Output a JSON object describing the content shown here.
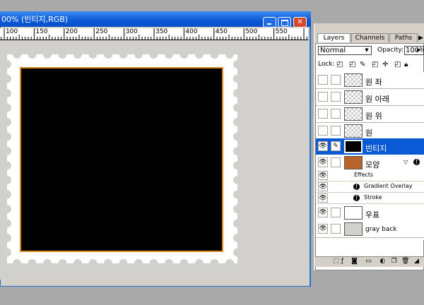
{
  "document": {
    "title": "00% (빈티지,RGB)",
    "ruler_ticks": [
      "100",
      "150",
      "200",
      "250",
      "300",
      "350",
      "400",
      "450",
      "500",
      "550"
    ]
  },
  "layers_panel": {
    "tabs": [
      "Layers",
      "Channels",
      "Paths"
    ],
    "blend_mode": "Normal",
    "opacity_label": "Opacity:",
    "opacity_value": "100%",
    "lock_label": "Lock:",
    "layers": [
      {
        "name": "원 좌",
        "visible": false
      },
      {
        "name": "원 아래",
        "visible": false
      },
      {
        "name": "원 위",
        "visible": false
      },
      {
        "name": "원",
        "visible": false
      },
      {
        "name": "빈티지",
        "visible": true,
        "selected": true
      },
      {
        "name": "모양",
        "visible": true
      }
    ],
    "effects_label": "Effects",
    "effects": [
      "Gradient Overlay",
      "Stroke"
    ],
    "bottom_layers": [
      {
        "name": "우표",
        "visible": true
      },
      {
        "name": "gray back",
        "visible": true
      }
    ]
  },
  "colors": {
    "shape_thumb": "#b8632a",
    "selection": "#0a5ad6",
    "stamp_border": "#d6891c"
  }
}
